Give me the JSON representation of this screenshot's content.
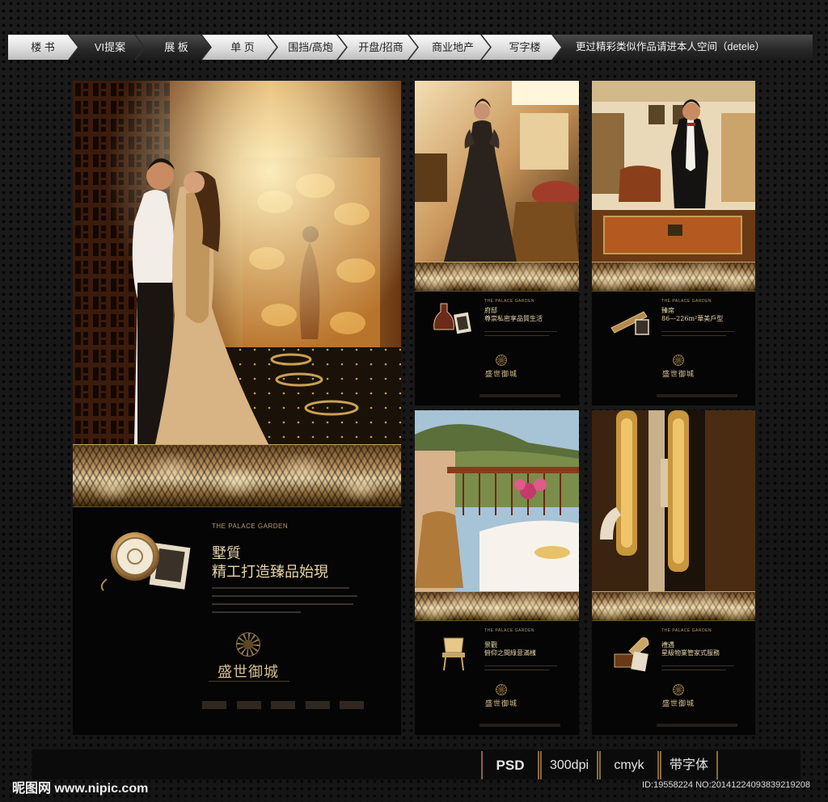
{
  "nav": {
    "items": [
      {
        "label": "楼 书",
        "style": "light"
      },
      {
        "label": "VI提案",
        "style": "dark"
      },
      {
        "label": "展 板",
        "style": "dark"
      },
      {
        "label": "单 页",
        "style": "light"
      },
      {
        "label": "围挡/高炮",
        "style": "light"
      },
      {
        "label": "开盘/招商",
        "style": "light"
      },
      {
        "label": "商业地产",
        "style": "light"
      },
      {
        "label": "写字楼",
        "style": "light"
      },
      {
        "label": "更过精彩类似作品请进本人空间（detele）",
        "style": "dark"
      }
    ]
  },
  "main_panel": {
    "en_title": "THE PALACE GARDEN",
    "headline_line1": "墅質",
    "headline_line2": "精工打造臻品始現",
    "logo_text": "盛世御城",
    "icon": "pocket-watch-icon"
  },
  "small_panels": [
    {
      "en_title": "THE PALACE GARDEN",
      "headline": "府邸",
      "subline": "尊崇私密享品質生活",
      "logo_text": "盛世御城",
      "icon": "decanter-icon"
    },
    {
      "en_title": "THE PALACE GARDEN",
      "headline": "臻席",
      "subline": "86—226m²華美戶型",
      "logo_text": "盛世御城",
      "icon": "telescope-icon"
    },
    {
      "en_title": "THE PALACE GARDEN",
      "headline": "景觀",
      "subline": "俯仰之間綠意滿樣",
      "logo_text": "盛世御城",
      "icon": "chair-icon"
    },
    {
      "en_title": "THE PALACE GARDEN",
      "headline": "禮遇",
      "subline": "星級物業管家式服務",
      "logo_text": "盛世御城",
      "icon": "gramophone-icon"
    }
  ],
  "badges": [
    "PSD",
    "300dpi",
    "cmyk",
    "带字体"
  ],
  "watermark": {
    "site": "昵图网 www.nipic.com",
    "id": "ID:19558224 NO:20141224093839219208"
  },
  "colors": {
    "gold": "#c9a56a",
    "background": "#141414",
    "panel": "#050505"
  }
}
